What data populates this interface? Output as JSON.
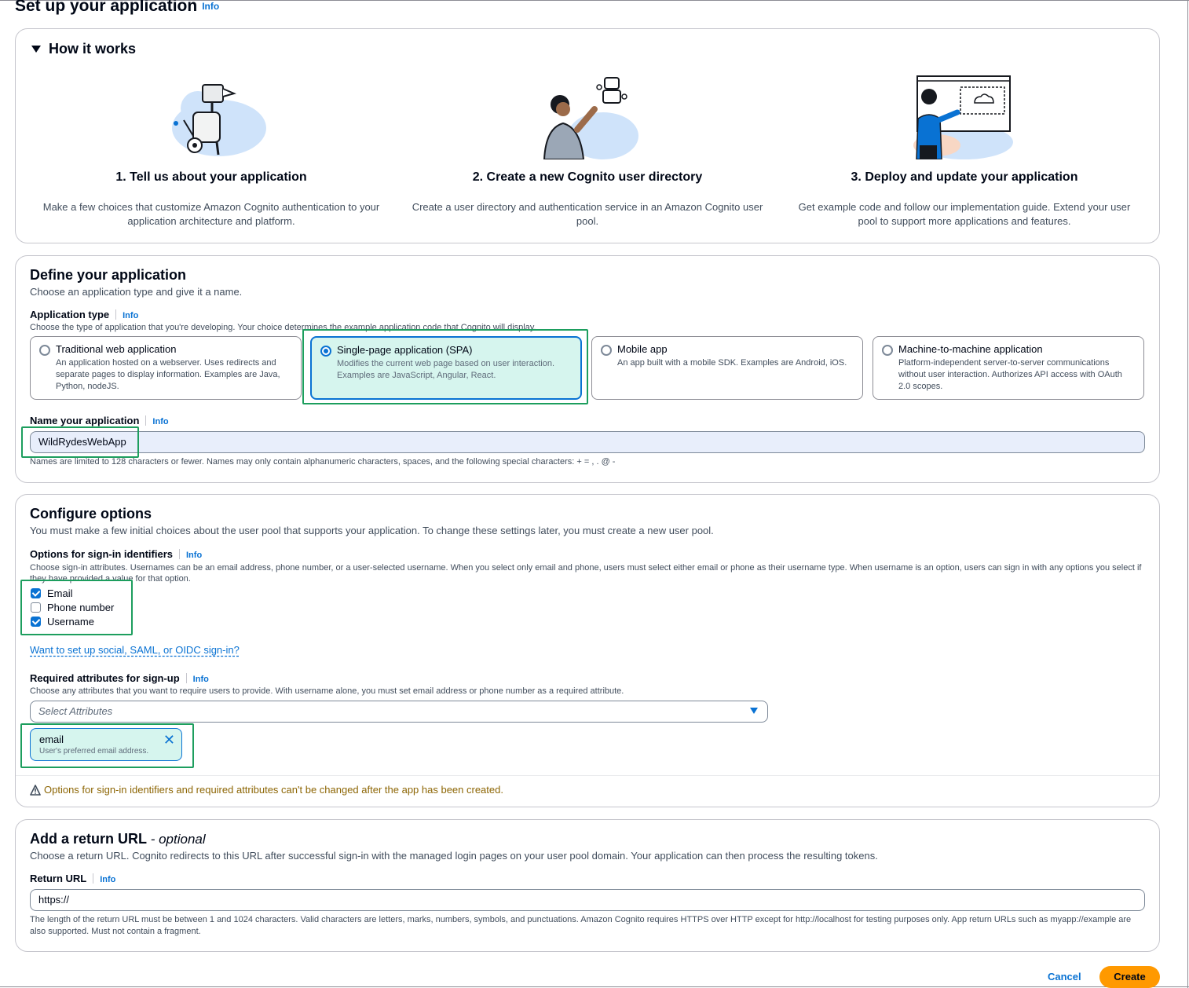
{
  "page": {
    "title": "Set up your application",
    "info": "Info"
  },
  "how_it_works": {
    "heading": "How it works",
    "steps": [
      {
        "title": "1. Tell us about your application",
        "desc": "Make a few choices that customize Amazon Cognito authentication to your application architecture and platform."
      },
      {
        "title": "2. Create a new Cognito user directory",
        "desc": "Create a user directory and authentication service in an Amazon Cognito user pool."
      },
      {
        "title": "3. Deploy and update your application",
        "desc": "Get example code and follow our implementation guide. Extend your user pool to support more applications and features."
      }
    ]
  },
  "define": {
    "title": "Define your application",
    "desc": "Choose an application type and give it a name.",
    "type_label": "Application type",
    "type_hint": "Choose the type of application that you're developing. Your choice determines the example application code that Cognito will display.",
    "types": [
      {
        "title": "Traditional web application",
        "desc": "An application hosted on a webserver. Uses redirects and separate pages to display information. Examples are Java, Python, nodeJS.",
        "selected": false
      },
      {
        "title": "Single-page application (SPA)",
        "desc": "Modifies the current web page based on user interaction. Examples are JavaScript, Angular, React.",
        "selected": true
      },
      {
        "title": "Mobile app",
        "desc": "An app built with a mobile SDK. Examples are Android, iOS.",
        "selected": false
      },
      {
        "title": "Machine-to-machine application",
        "desc": "Platform-independent server-to-server communications without user interaction. Authorizes API access with OAuth 2.0 scopes.",
        "selected": false
      }
    ],
    "name_label": "Name your application",
    "name_value": "WildRydesWebApp",
    "name_hint": "Names are limited to 128 characters or fewer. Names may only contain alphanumeric characters, spaces, and the following special characters: + = , . @ -"
  },
  "configure": {
    "title": "Configure options",
    "desc": "You must make a few initial choices about the user pool that supports your application. To change these settings later, you must create a new user pool.",
    "signin_label": "Options for sign-in identifiers",
    "signin_hint": "Choose sign-in attributes. Usernames can be an email address, phone number, or a user-selected username. When you select only email and phone, users must select either email or phone as their username type. When username is an option, users can sign in with any options you select if they have provided a value for that option.",
    "identifiers": [
      {
        "label": "Email",
        "checked": true
      },
      {
        "label": "Phone number",
        "checked": false
      },
      {
        "label": "Username",
        "checked": true
      }
    ],
    "social_link": "Want to set up social, SAML, or OIDC sign-in?",
    "required_label": "Required attributes for sign-up",
    "required_hint": "Choose any attributes that you want to require users to provide. With username alone, you must set email address or phone number as a required attribute.",
    "select_placeholder": "Select Attributes",
    "token": {
      "name": "email",
      "desc": "User's preferred email address."
    },
    "warning": "Options for sign-in identifiers and required attributes can't be changed after the app has been created."
  },
  "return_url": {
    "title": "Add a return URL",
    "title_suffix": "- optional",
    "desc": "Choose a return URL. Cognito redirects to this URL after successful sign-in with the managed login pages on your user pool domain. Your application can then process the resulting tokens.",
    "label": "Return URL",
    "value": "https://",
    "hint_line1": "The length of the return URL must be between 1 and 1024 characters. Valid characters are letters, marks, numbers, symbols, and punctuations. Amazon Cognito requires HTTPS over HTTP except for http://localhost for testing purposes only. App return URLs such as myapp://example are",
    "hint_line2": "also supported. Must not contain a fragment."
  },
  "actions": {
    "cancel": "Cancel",
    "create": "Create"
  },
  "colors": {
    "accent": "#0972d3",
    "highlight": "#1d9e5e",
    "primary_button": "#ff9900",
    "selected_bg": "#d6f5ee",
    "warning": "#8d6605"
  }
}
